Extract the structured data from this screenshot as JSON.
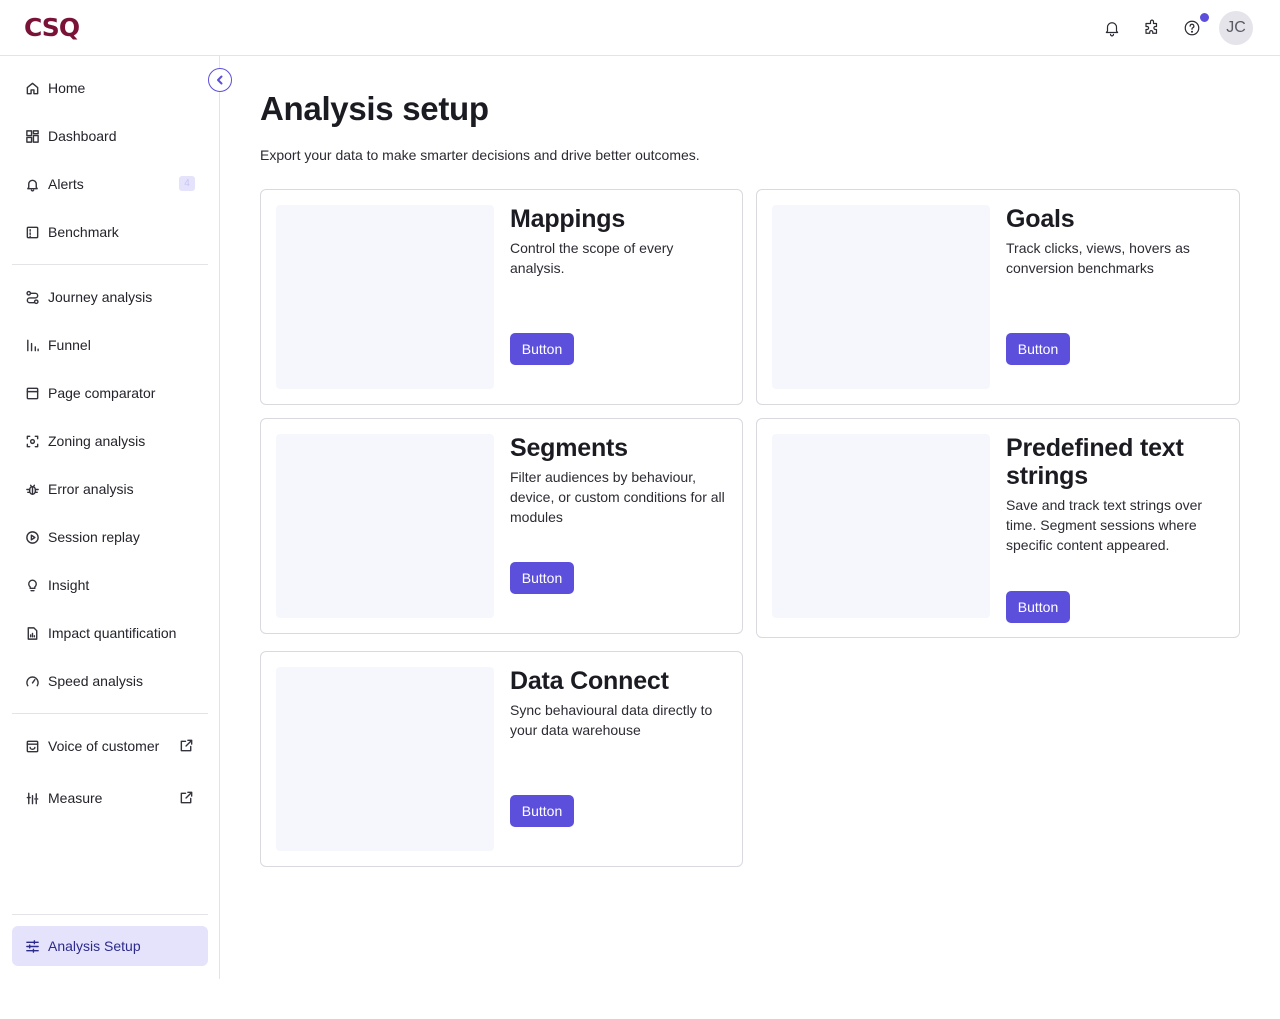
{
  "brand": {
    "logo_text": "CSQ",
    "logo_color": "#7a1238",
    "accent": "#5b4fdb"
  },
  "topbar": {
    "icons": [
      "bell-icon",
      "puzzle-icon",
      "help-icon"
    ],
    "avatar_initials": "JC"
  },
  "sidebar": {
    "items": [
      {
        "label": "Home",
        "icon": "home-icon"
      },
      {
        "label": "Dashboard",
        "icon": "dashboard-icon"
      },
      {
        "label": "Alerts",
        "icon": "bell-icon",
        "badge": "4"
      },
      {
        "label": "Benchmark",
        "icon": "benchmark-icon"
      },
      {
        "label": "Journey analysis",
        "icon": "journey-icon"
      },
      {
        "label": "Funnel",
        "icon": "funnel-icon"
      },
      {
        "label": "Page comparator",
        "icon": "page-comparator-icon"
      },
      {
        "label": "Zoning analysis",
        "icon": "zoning-icon"
      },
      {
        "label": "Error analysis",
        "icon": "bug-icon"
      },
      {
        "label": "Session replay",
        "icon": "play-icon"
      },
      {
        "label": "Insight",
        "icon": "lightbulb-icon"
      },
      {
        "label": "Impact quantification",
        "icon": "report-icon"
      },
      {
        "label": "Speed analysis",
        "icon": "gauge-icon"
      },
      {
        "label": "Voice of customer",
        "icon": "voc-icon",
        "external": true
      },
      {
        "label": "Measure",
        "icon": "measure-icon",
        "external": true
      }
    ],
    "footer_item": {
      "label": "Analysis Setup",
      "icon": "sliders-icon"
    }
  },
  "main": {
    "title": "Analysis setup",
    "subtitle": "Export your data to make smarter decisions and drive better outcomes.",
    "cards": [
      {
        "title": "Mappings",
        "description": "Control the scope of every analysis.",
        "button": "Button"
      },
      {
        "title": "Goals",
        "description": "Track clicks, views, hovers as conversion benchmarks",
        "button": "Button"
      },
      {
        "title": "Segments",
        "description": "Filter audiences by behaviour, device, or custom conditions for all modules",
        "button": "Button"
      },
      {
        "title": "Predefined text strings",
        "description": "Save and track text strings over time. Segment sessions where specific content appeared.",
        "button": "Button"
      },
      {
        "title": "Data Connect",
        "description": "Sync behavioural data directly to your data warehouse",
        "button": "Button"
      }
    ]
  }
}
